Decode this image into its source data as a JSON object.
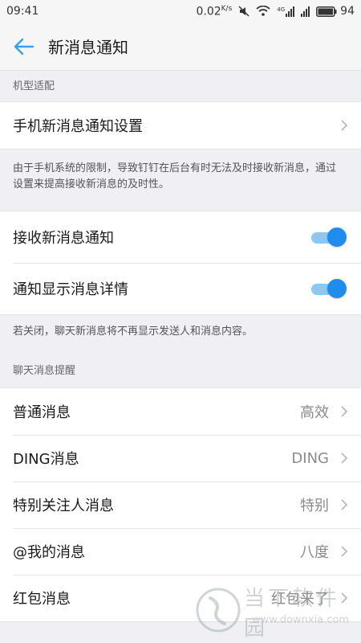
{
  "status": {
    "time": "09:41",
    "speed": "0.02",
    "speed_unit": "K/s",
    "network_label": "4G",
    "battery": "94"
  },
  "header": {
    "title": "新消息通知"
  },
  "sections": {
    "device": {
      "label": "机型适配",
      "item": "手机新消息通知设置",
      "note": "由于手机系统的限制，导致钉钉在后台有时无法及时接收新消息，通过设置来提高接收新消息的及时性。"
    },
    "toggles": {
      "receive_label": "接收新消息通知",
      "receive_on": true,
      "detail_label": "通知显示消息详情",
      "detail_on": true,
      "note": "若关闭，聊天新消息将不再显示发送人和消息内容。"
    },
    "reminders": {
      "label": "聊天消息提醒",
      "items": [
        {
          "label": "普通消息",
          "value": "高效"
        },
        {
          "label": "DING消息",
          "value": "DING"
        },
        {
          "label": "特别关注人消息",
          "value": "特别"
        },
        {
          "label": "@我的消息",
          "value": "八度"
        },
        {
          "label": "红包消息",
          "value": "红包来了"
        }
      ]
    }
  },
  "watermark": {
    "text": "当下软件园",
    "url": "www.downxia.com"
  },
  "colors": {
    "accent": "#1f8ded",
    "back_arrow": "#3aa0e8"
  }
}
